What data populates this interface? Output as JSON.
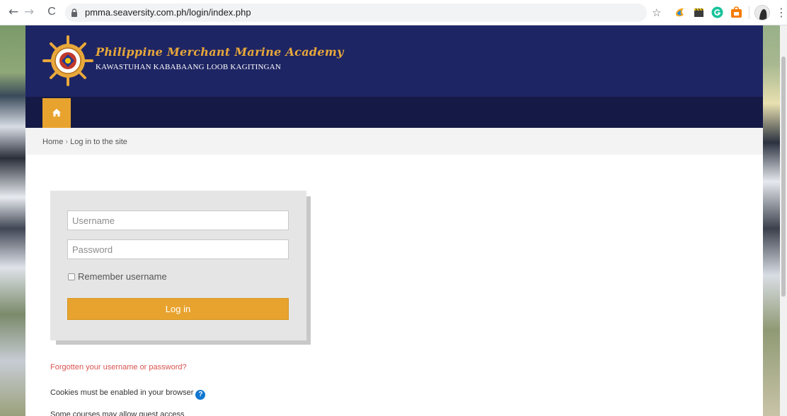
{
  "browser": {
    "url": "pmma.seaversity.com.ph/login/index.php",
    "back_glyph": "←",
    "forward_glyph": "→",
    "reload_glyph": "C",
    "star_glyph": "☆",
    "menu_glyph": "⋮",
    "extension_icons": [
      "dynamic-ext-icon",
      "clapper-ext-icon",
      "grammarly-ext-icon",
      "shopping-ext-icon"
    ]
  },
  "header": {
    "title": "Philippine Merchant Marine Academy",
    "subtitle": "KAWASTUHAN   KABABAANG LOOB   KAGITINGAN",
    "brand_color": "#1e2564",
    "accent_color": "#e8a32e"
  },
  "breadcrumb": {
    "home": "Home",
    "separator": "›",
    "current": "Log in to the site"
  },
  "login": {
    "username_placeholder": "Username",
    "password_placeholder": "Password",
    "remember_label": "Remember username",
    "submit_label": "Log in"
  },
  "links": {
    "forgot": "Forgotten your username or password?",
    "cookies": "Cookies must be enabled in your browser",
    "help_glyph": "?",
    "guest": "Some courses may allow guest access"
  }
}
